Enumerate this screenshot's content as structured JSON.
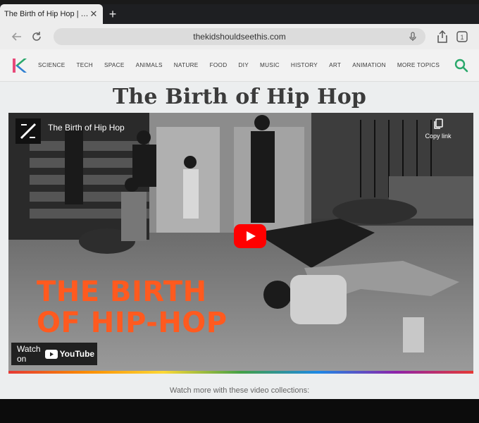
{
  "browser": {
    "tab_title": "The Birth of Hip Hop | Th",
    "url": "thekidshouldseethis.com",
    "tab_count": "1"
  },
  "site": {
    "nav": [
      "SCIENCE",
      "TECH",
      "SPACE",
      "ANIMALS",
      "NATURE",
      "FOOD",
      "DIY",
      "MUSIC",
      "HISTORY",
      "ART",
      "ANIMATION",
      "MORE TOPICS"
    ],
    "logo_letter": "K"
  },
  "page": {
    "title": "The Birth of Hip Hop",
    "caption": "Watch more with these video collections:"
  },
  "video": {
    "title": "The Birth of Hip Hop",
    "copy_link": "Copy link",
    "overlay_line1": "THE BIRTH",
    "overlay_line2": "OF HIP-HOP",
    "watch_on": "Watch on",
    "youtube": "YouTube"
  },
  "colors": {
    "accent_green": "#2aa86b",
    "overlay_orange": "#ff5a1f",
    "play_red": "#ff0000"
  },
  "icons": {
    "back": "back-arrow-icon",
    "reload": "reload-icon",
    "mic": "mic-icon",
    "share": "share-icon",
    "tabs": "tabs-icon",
    "search": "search-icon",
    "copy": "copy-link-icon",
    "play": "play-icon"
  }
}
